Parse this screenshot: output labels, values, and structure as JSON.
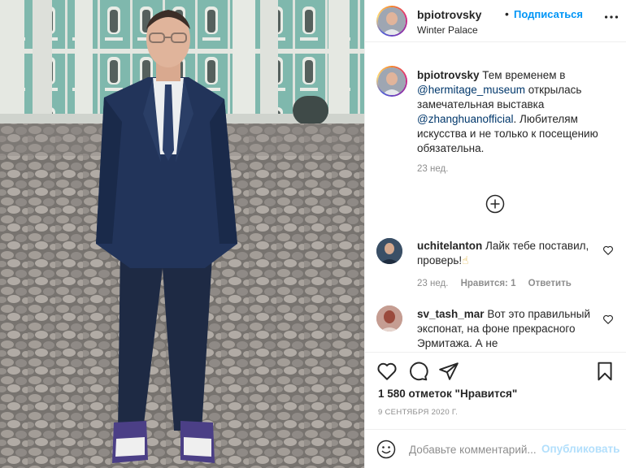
{
  "header": {
    "username": "bpiotrovsky",
    "separator": "•",
    "follow_label": "Подписаться",
    "location": "Winter Palace",
    "more_icon": "more-horizontal-icon"
  },
  "caption": {
    "username": "bpiotrovsky",
    "text_1": "Тем временем в",
    "mention_1": "@hermitage_museum",
    "text_2": "открылась замечательная выставка",
    "mention_2": "@zhanghuanofficial",
    "text_3": ". Любителям искусства и не только к посещению обязательна.",
    "time": "23 нед."
  },
  "load_more_icon": "plus-circle-icon",
  "comments": [
    {
      "username": "uchitelanton",
      "text": "Лайк тебе поставил, проверь!",
      "emoji": "☝",
      "time": "23 нед.",
      "likes": "Нравится: 1",
      "reply": "Ответить"
    },
    {
      "username": "sv_tash_mar",
      "text": "Вот это правильный экспонат, на фоне прекрасного Эрмитажа. А не"
    }
  ],
  "likes_count": "1 580 отметок \"Нравится\"",
  "date": "9 СЕНТЯБРЯ 2020 Г.",
  "add_comment": {
    "placeholder": "Добавьте комментарий...",
    "publish_label": "Опубликовать"
  },
  "colors": {
    "accent": "#0095f6",
    "mention": "#00376b",
    "muted": "#8e8e8e",
    "publish_disabled": "#b2dffc",
    "facade": "#7fb8ad"
  }
}
